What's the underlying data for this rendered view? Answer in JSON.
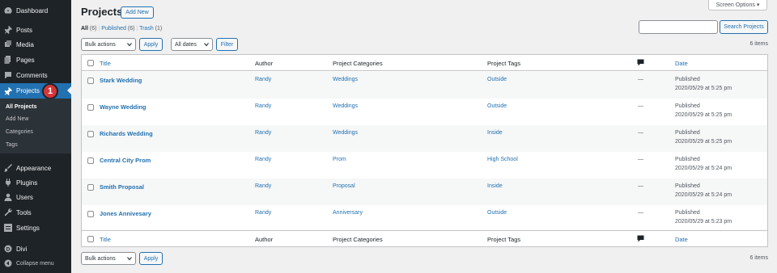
{
  "sidebar": {
    "items": [
      {
        "label": "Dashboard",
        "icon": "dashboard-icon"
      },
      {
        "label": "Posts",
        "icon": "pin-icon"
      },
      {
        "label": "Media",
        "icon": "media-icon"
      },
      {
        "label": "Pages",
        "icon": "pages-icon"
      },
      {
        "label": "Comments",
        "icon": "comments-icon"
      },
      {
        "label": "Projects",
        "icon": "pin-icon",
        "active": true,
        "badge": "1"
      },
      {
        "label": "Appearance",
        "icon": "brush-icon"
      },
      {
        "label": "Plugins",
        "icon": "plugin-icon"
      },
      {
        "label": "Users",
        "icon": "users-icon"
      },
      {
        "label": "Tools",
        "icon": "wrench-icon"
      },
      {
        "label": "Settings",
        "icon": "settings-icon"
      },
      {
        "label": "Divi",
        "icon": "divi-icon"
      },
      {
        "label": "Collapse menu",
        "icon": "collapse-icon"
      }
    ],
    "submenu": [
      "All Projects",
      "Add New",
      "Categories",
      "Tags"
    ]
  },
  "header": {
    "title": "Projects",
    "add_new": "Add New",
    "screen_options": "Screen Options ▾"
  },
  "filters": {
    "all_label": "All",
    "all_count": "(6)",
    "published_label": "Published",
    "published_count": "(6)",
    "trash_label": "Trash",
    "trash_count": "(1)",
    "sep": "|"
  },
  "actions": {
    "bulk_actions": "Bulk actions",
    "apply": "Apply",
    "all_dates": "All dates",
    "filter": "Filter",
    "search_button": "Search Projects",
    "items_count": "6 items"
  },
  "table": {
    "columns": [
      "Title",
      "Author",
      "Project Categories",
      "Project Tags",
      "Date"
    ],
    "rows": [
      {
        "title": "Stark Wedding",
        "author": "Randy",
        "category": "Weddings",
        "tag": "Outside",
        "comments": "—",
        "status": "Published",
        "date": "2020/05/29 at 5:25 pm"
      },
      {
        "title": "Wayne Wedding",
        "author": "Randy",
        "category": "Weddings",
        "tag": "Outside",
        "comments": "—",
        "status": "Published",
        "date": "2020/05/29 at 5:25 pm"
      },
      {
        "title": "Richards Wedding",
        "author": "Randy",
        "category": "Weddings",
        "tag": "Inside",
        "comments": "—",
        "status": "Published",
        "date": "2020/05/29 at 5:25 pm"
      },
      {
        "title": "Central City Prom",
        "author": "Randy",
        "category": "Prom",
        "tag": "High School",
        "comments": "—",
        "status": "Published",
        "date": "2020/05/29 at 5:24 pm"
      },
      {
        "title": "Smith Proposal",
        "author": "Randy",
        "category": "Proposal",
        "tag": "Inside",
        "comments": "—",
        "status": "Published",
        "date": "2020/05/29 at 5:24 pm"
      },
      {
        "title": "Jones Annivesary",
        "author": "Randy",
        "category": "Anniversary",
        "tag": "Outside",
        "comments": "—",
        "status": "Published",
        "date": "2020/05/29 at 5:23 pm"
      }
    ]
  },
  "colors": {
    "accent": "#2271b1",
    "sidebar_bg": "#1d2327",
    "badge": "#d63638"
  }
}
